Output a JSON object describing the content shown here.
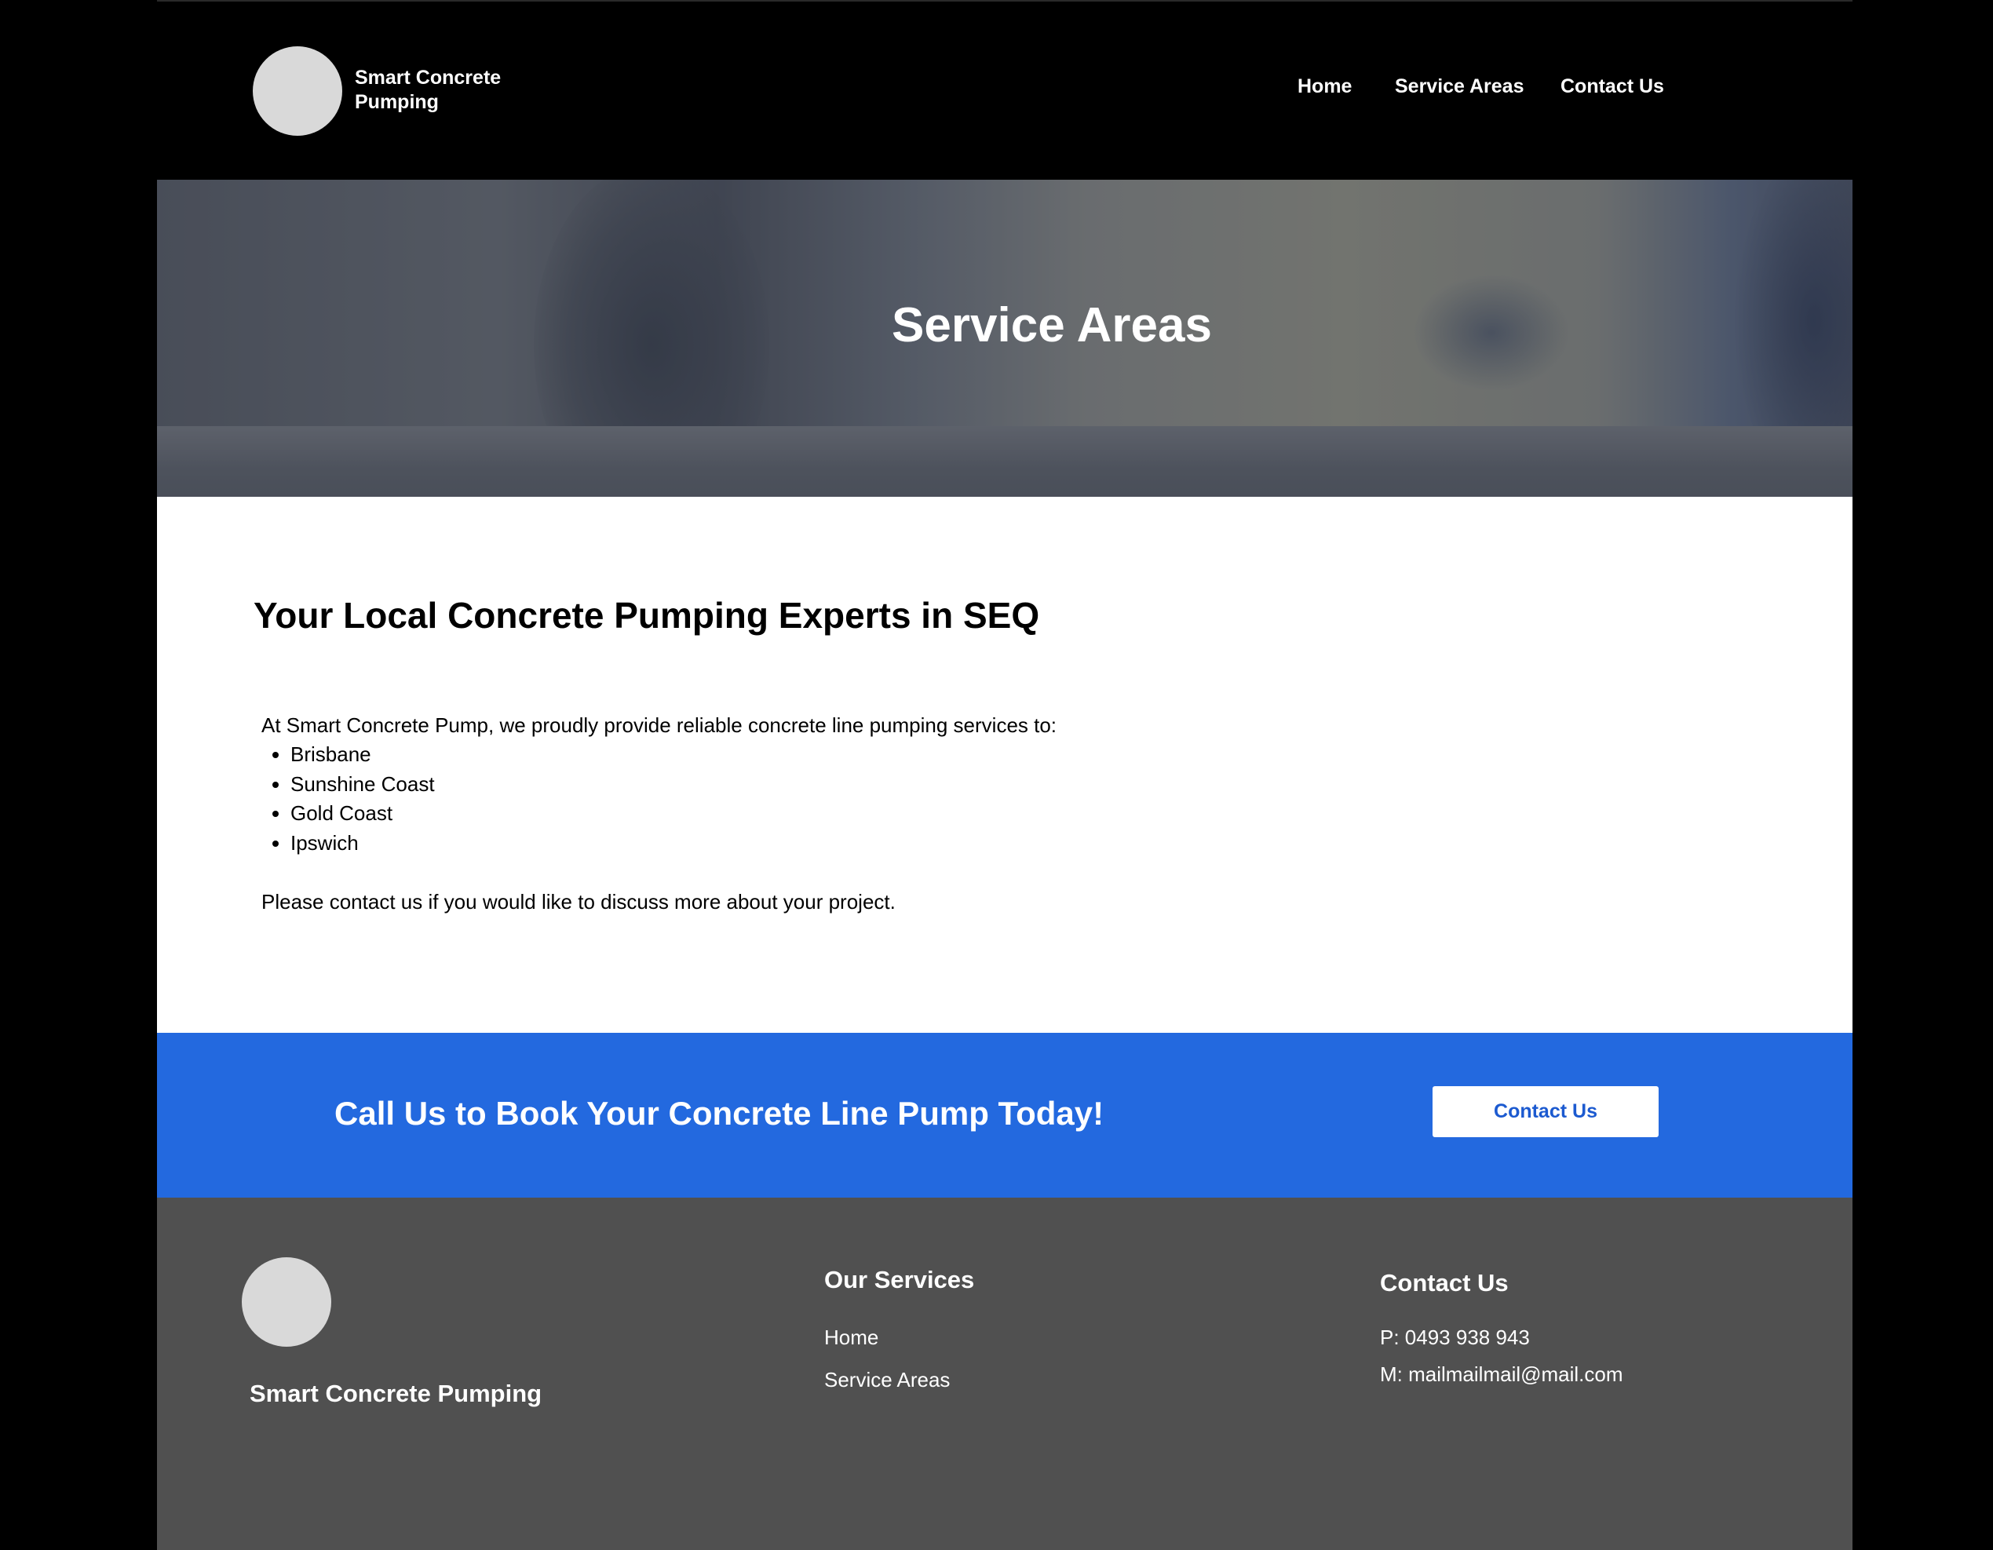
{
  "header": {
    "brand": "Smart Concrete Pumping",
    "nav": {
      "home": "Home",
      "service_areas": "Service Areas",
      "contact": "Contact Us"
    }
  },
  "hero": {
    "title": "Service Areas"
  },
  "main": {
    "heading": "Your Local Concrete Pumping Experts in SEQ",
    "intro": "At Smart Concrete Pump, we proudly provide reliable concrete line pumping services to:",
    "areas": [
      "Brisbane",
      "Sunshine Coast",
      "Gold Coast",
      "Ipswich"
    ],
    "outro": "Please contact us if you would like to discuss more about your project."
  },
  "cta": {
    "text": "Call Us to Book Your Concrete Line Pump Today!",
    "button_label": "Contact Us",
    "background_color": "#2369df"
  },
  "footer": {
    "brand": "Smart Concrete Pumping",
    "services_heading": "Our Services",
    "services_links": [
      "Home",
      "Service Areas"
    ],
    "contact_heading": "Contact Us",
    "phone": "P: 0493 938 943",
    "email": "M: mailmailmail@mail.com"
  },
  "colors": {
    "header_bg": "#000000",
    "footer_bg": "#505050",
    "cta_button_text": "#1c5ad0",
    "logo_placeholder": "#d9d9d9"
  }
}
